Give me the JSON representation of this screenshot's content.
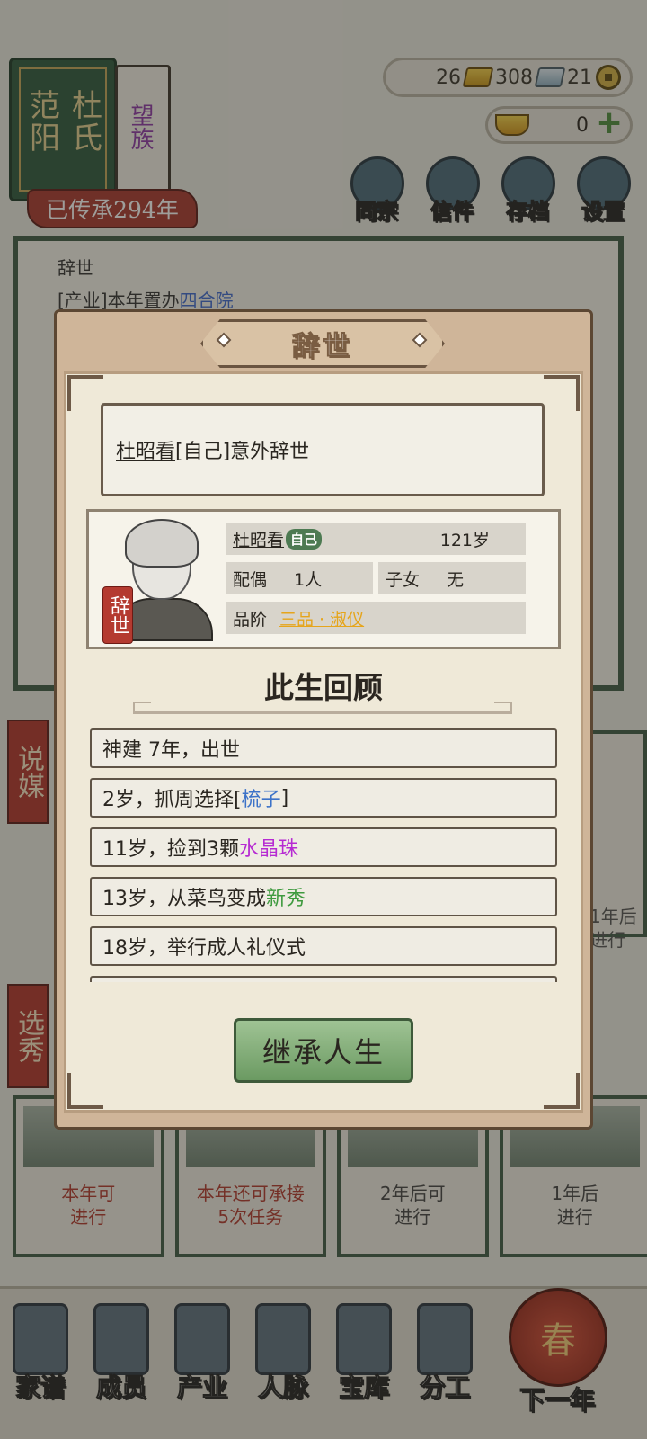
{
  "clan": {
    "region": "范阳",
    "surname": "杜氏",
    "rank_tag": "望族",
    "inheritance": "已传承294年"
  },
  "resources": {
    "gold": "26",
    "silver": "308",
    "coin": "21",
    "yuanbao": "0"
  },
  "top_buttons": [
    "同宗",
    "信件",
    "存档",
    "设置"
  ],
  "log": {
    "line1": "辞世",
    "line2_prefix": "[产业]本年置办",
    "line2_highlight": "四合院"
  },
  "side_tags": {
    "matchmaking": "说媒",
    "selection": "选秀"
  },
  "cards": [
    {
      "line1": "本年可",
      "line2": "进行",
      "tone": "red"
    },
    {
      "line1": "本年还可承接",
      "line2": "5次任务",
      "tone": "red"
    },
    {
      "line1": "2年后可",
      "line2": "进行",
      "tone": "dark"
    },
    {
      "line1": "1年后",
      "line2": "进行",
      "tone": "dark"
    }
  ],
  "side_card_upper": {
    "line1": "1年后",
    "line2": "进行"
  },
  "bottom_nav": [
    "家谱",
    "成员",
    "产业",
    "人脉",
    "宝库",
    "分工",
    "下一年"
  ],
  "lantern": "春",
  "modal": {
    "title": "辞世",
    "event": {
      "name": "杜昭看",
      "suffix": "[自己]意外辞世"
    },
    "profile": {
      "name": "杜昭看",
      "self_tag": "自己",
      "age": "121岁",
      "spouse_label": "配偶",
      "spouse_value": "1人",
      "children_label": "子女",
      "children_value": "无",
      "rank_label": "品阶",
      "rank_value": "三品 · 淑仪",
      "seal": "辞世"
    },
    "review_title": "此生回顾",
    "life_events": [
      {
        "text": "神建 7年，出世",
        "highlight": "",
        "after": "",
        "color": ""
      },
      {
        "text": "2岁，抓周选择[",
        "highlight": "梳子",
        "after": "]",
        "color": "blue"
      },
      {
        "text": "11岁，捡到3颗",
        "highlight": "水晶珠",
        "after": "",
        "color": "purple"
      },
      {
        "text": "13岁，从菜鸟变成",
        "highlight": "新秀",
        "after": "",
        "color": "green"
      },
      {
        "text": "18岁，举行成人礼仪式",
        "highlight": "",
        "after": "",
        "color": ""
      }
    ],
    "inherit_button": "继承人生"
  }
}
